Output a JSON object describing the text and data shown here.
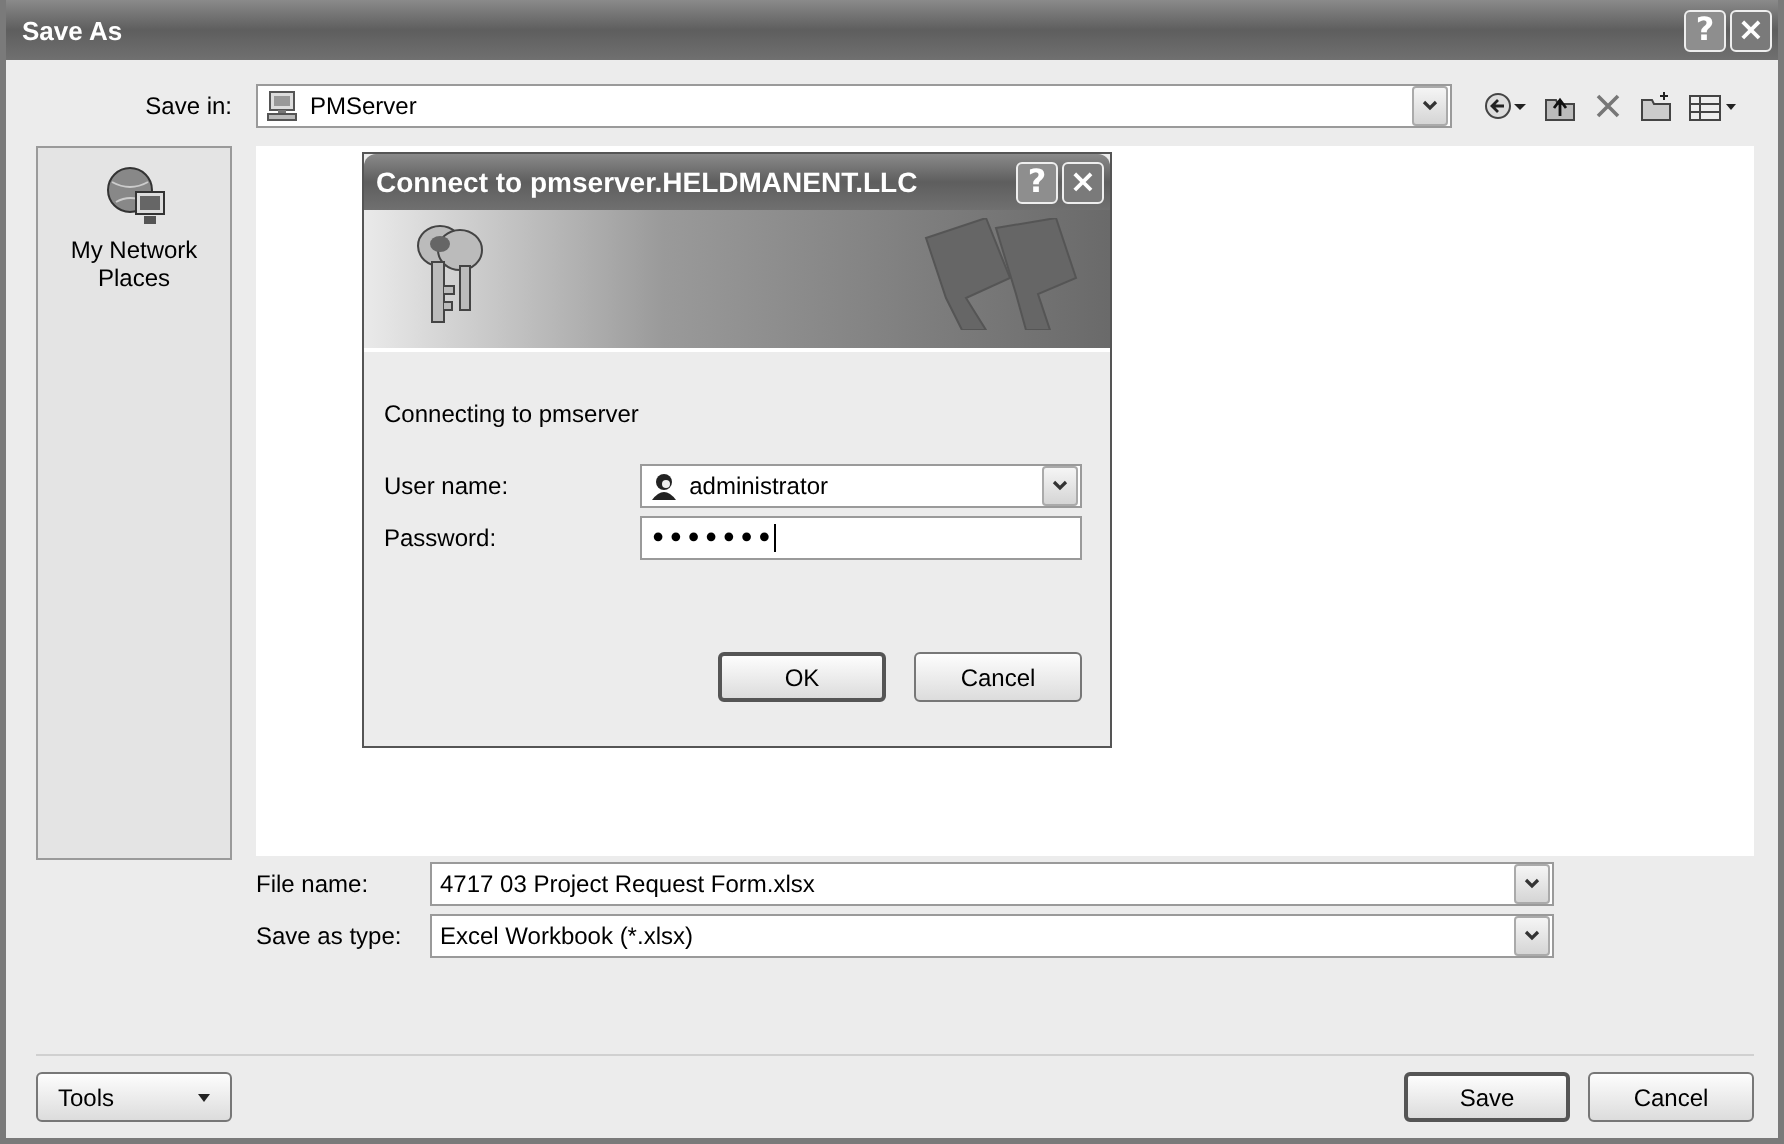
{
  "window": {
    "title": "Save As",
    "buttons": [
      {
        "kind": "help",
        "label": "?"
      },
      {
        "kind": "close",
        "label": "×"
      }
    ]
  },
  "save_in": {
    "label": "Save in:",
    "value": "PMServer"
  },
  "toolbar": [
    {
      "kind": "back"
    },
    {
      "kind": "up"
    },
    {
      "kind": "delete"
    },
    {
      "kind": "new-folder"
    },
    {
      "kind": "views"
    }
  ],
  "places": [
    {
      "label": "My Network Places",
      "selected": false
    }
  ],
  "dialog": {
    "title": "Connect to pmserver.HELDMANENT.LLC",
    "buttons": [
      {
        "kind": "help",
        "label": "?"
      },
      {
        "kind": "close",
        "label": "×"
      }
    ],
    "message": "Connecting to pmserver",
    "fields": [
      {
        "kind": "combo",
        "label": "User name:",
        "value": "administrator"
      },
      {
        "kind": "password",
        "label": "Password:",
        "value": "•••••••"
      }
    ],
    "actions": [
      {
        "label": "OK",
        "default": true
      },
      {
        "label": "Cancel",
        "default": false
      }
    ]
  },
  "file_fields": [
    {
      "label": "File name:",
      "value": "4717 03 Project Request Form.xlsx"
    },
    {
      "label": "Save as type:",
      "value": "Excel Workbook (*.xlsx)"
    }
  ],
  "tools": {
    "label": "Tools"
  },
  "actions": [
    {
      "label": "Save",
      "default": true
    },
    {
      "label": "Cancel",
      "default": false
    }
  ]
}
